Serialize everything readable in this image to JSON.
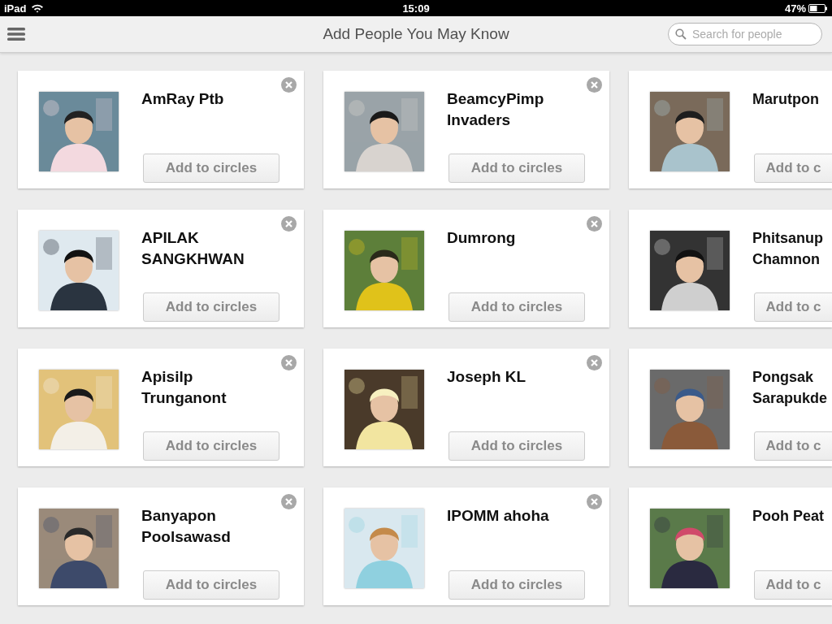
{
  "status_bar": {
    "device": "iPad",
    "time": "15:09",
    "battery": "47%"
  },
  "header": {
    "title": "Add People You May Know",
    "search": {
      "placeholder": "Search for people"
    }
  },
  "cards": [
    {
      "name": "AmRay Ptb",
      "action": "Add to circles"
    },
    {
      "name": "BeamcyPimp Invaders",
      "action": "Add to circles"
    },
    {
      "name": "Marutpon",
      "action": "Add to c"
    },
    {
      "name": "APILAK SANGKHWAN",
      "action": "Add to circles"
    },
    {
      "name": "Dumrong",
      "action": "Add to circles"
    },
    {
      "name": "Phitsanup Chamnon",
      "action": "Add to c"
    },
    {
      "name": "Apisilp Trunganont",
      "action": "Add to circles"
    },
    {
      "name": "Joseph KL",
      "action": "Add to circles"
    },
    {
      "name": "Pongsak Sarapukde",
      "action": "Add to c"
    },
    {
      "name": "Banyapon Poolsawasd",
      "action": "Add to circles"
    },
    {
      "name": "IPOMM ahoha",
      "action": "Add to circles"
    },
    {
      "name": "Pooh Peat",
      "action": "Add to c"
    }
  ]
}
